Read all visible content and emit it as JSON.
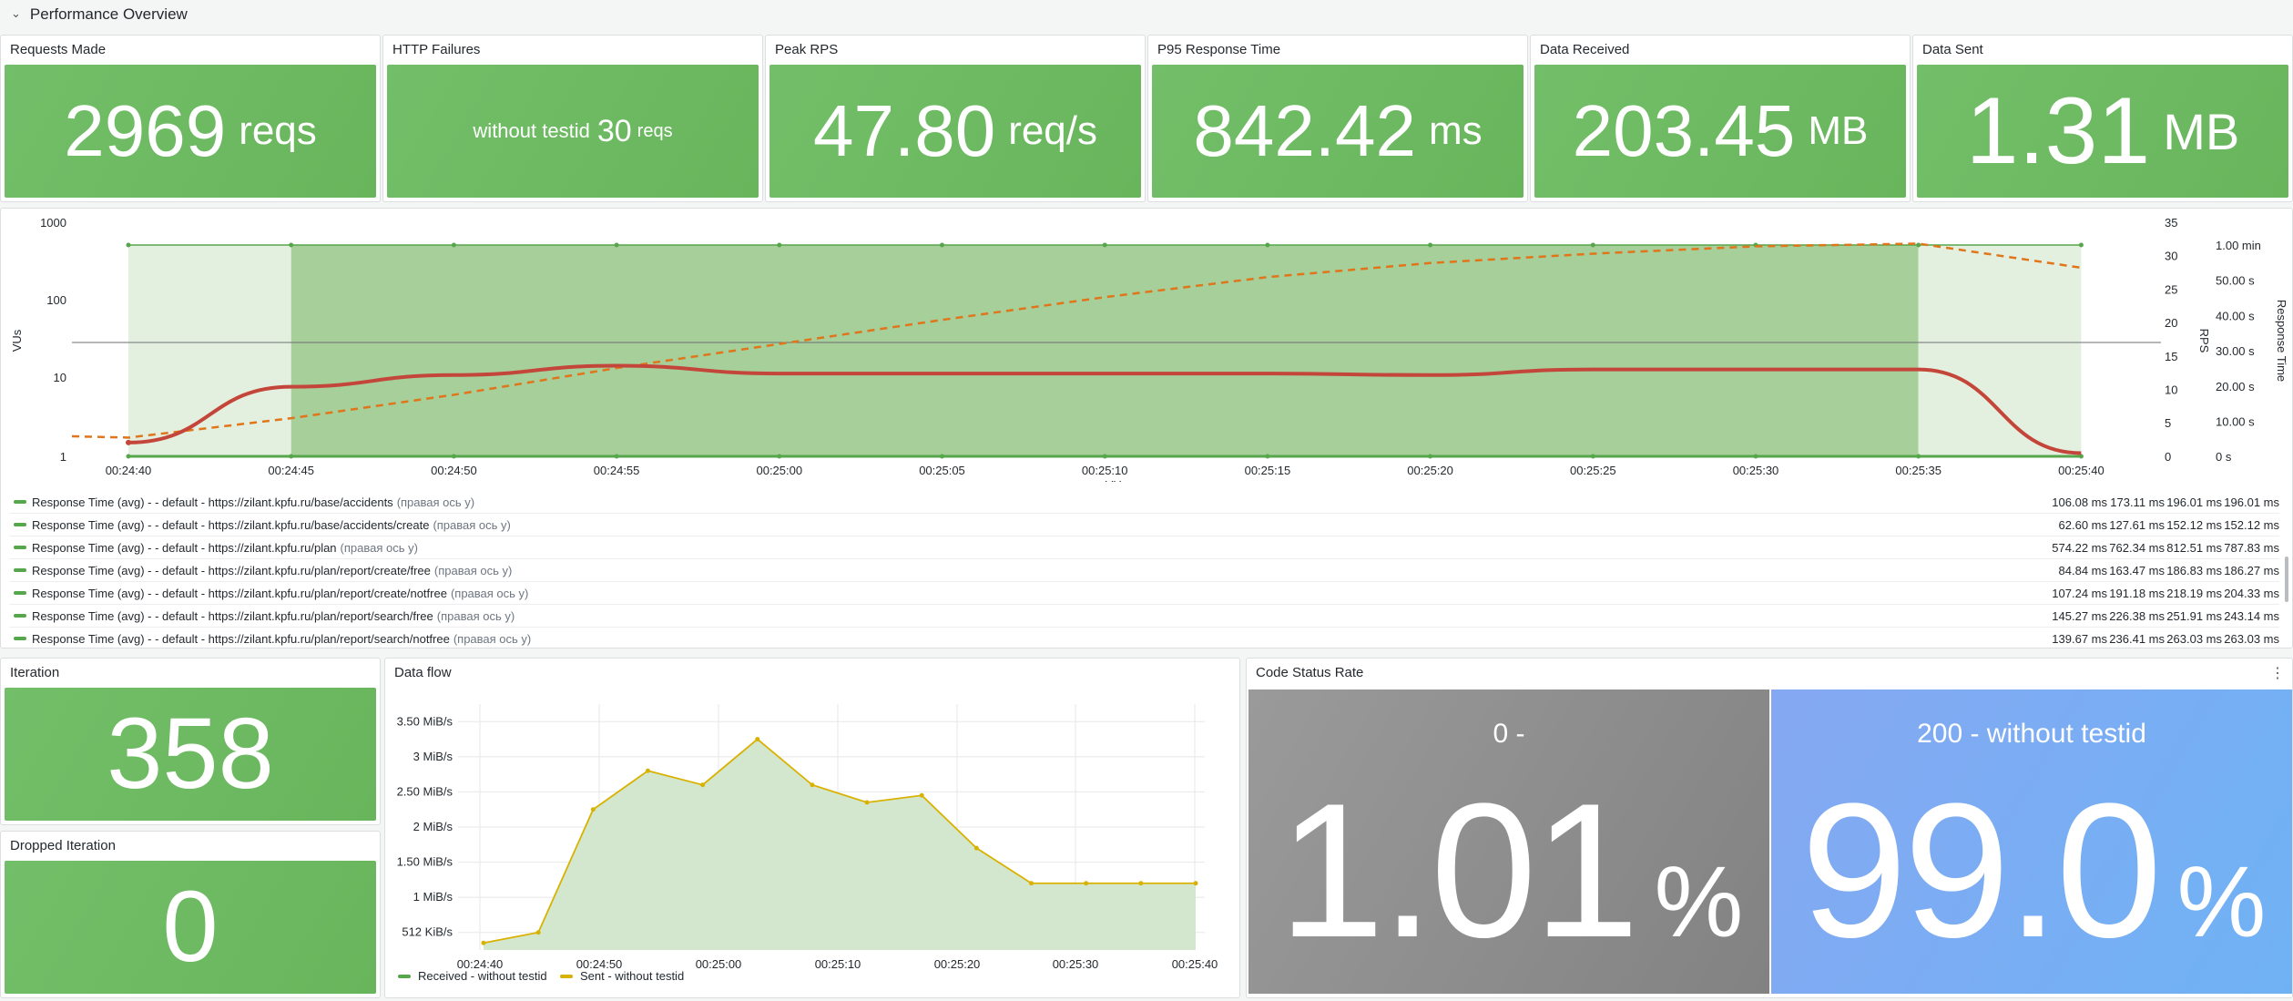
{
  "row": {
    "title": "Performance Overview",
    "chevron_icon": "chevron-down-icon"
  },
  "stats": {
    "requests": {
      "title": "Requests Made",
      "value": "2969",
      "unit": "reqs"
    },
    "failures": {
      "title": "HTTP Failures",
      "prefix": "without testid",
      "value": "30",
      "unit": "reqs"
    },
    "peak_rps": {
      "title": "Peak RPS",
      "value": "47.80",
      "unit": "req/s"
    },
    "p95": {
      "title": "P95 Response Time",
      "value": "842.42",
      "unit": "ms"
    },
    "received": {
      "title": "Data Received",
      "value": "203.45",
      "unit": "MB"
    },
    "sent": {
      "title": "Data Sent",
      "value": "1.31",
      "unit": "MB"
    },
    "iteration": {
      "title": "Iteration",
      "value": "358"
    },
    "dropped": {
      "title": "Dropped Iteration",
      "value": "0"
    }
  },
  "colors": {
    "stat_green": "#73bf69",
    "line_red": "#c4463a",
    "line_orange": "#e0751a",
    "gray_tile": "#8e8e8e",
    "blue_tile": "#7aa8f0"
  },
  "chart_data": [
    {
      "type": "line",
      "x_ticks": [
        "00:24:40",
        "00:24:45",
        "00:24:50",
        "00:24:55",
        "00:25:00",
        "00:25:05",
        "00:25:10",
        "00:25:15",
        "00:25:20",
        "00:25:25",
        "00:25:30",
        "00:25:35",
        "00:25:40"
      ],
      "xlabel": "VUs",
      "ylabel_left": "VUs",
      "ylabel_rps": "RPS",
      "ylabel_right": "Response Time",
      "left_ticks": [
        "1000",
        "100",
        "10",
        "1"
      ],
      "rps_ticks": [
        "35",
        "30",
        "25",
        "20",
        "15",
        "10",
        "5",
        "0"
      ],
      "rt_ticks": [
        "1.00 min",
        "50.00 s",
        "40.00 s",
        "30.00 s",
        "20.00 s",
        "10.00 s",
        "0 s"
      ],
      "vus_line": [
        1.5,
        7.8,
        11,
        14.5,
        11.5,
        11.5,
        11.5,
        11.5,
        11,
        13,
        13,
        13,
        1.1
      ],
      "rps_line": [
        2.8,
        5.7,
        9.2,
        13.2,
        16.8,
        20.4,
        23.8,
        26.8,
        28.9,
        30.3,
        31.4,
        31.8,
        28.2
      ],
      "legend": [
        {
          "label": "Response Time (avg) - - default - https://zilant.kpfu.ru/base/accidents",
          "suffix": "(правая ось y)",
          "v1": "106.08 ms",
          "v2": "173.11 ms",
          "v3": "196.01 ms",
          "v4": "196.01 ms"
        },
        {
          "label": "Response Time (avg) - - default - https://zilant.kpfu.ru/base/accidents/create",
          "suffix": "(правая ось y)",
          "v1": "62.60 ms",
          "v2": "127.61 ms",
          "v3": "152.12 ms",
          "v4": "152.12 ms"
        },
        {
          "label": "Response Time (avg) - - default - https://zilant.kpfu.ru/plan",
          "suffix": "(правая ось y)",
          "v1": "574.22 ms",
          "v2": "762.34 ms",
          "v3": "812.51 ms",
          "v4": "787.83 ms"
        },
        {
          "label": "Response Time (avg) - - default - https://zilant.kpfu.ru/plan/report/create/free",
          "suffix": "(правая ось y)",
          "v1": "84.84 ms",
          "v2": "163.47 ms",
          "v3": "186.83 ms",
          "v4": "186.27 ms"
        },
        {
          "label": "Response Time (avg) - - default - https://zilant.kpfu.ru/plan/report/create/notfree",
          "suffix": "(правая ось y)",
          "v1": "107.24 ms",
          "v2": "191.18 ms",
          "v3": "218.19 ms",
          "v4": "204.33 ms"
        },
        {
          "label": "Response Time (avg) - - default - https://zilant.kpfu.ru/plan/report/search/free",
          "suffix": "(правая ось y)",
          "v1": "145.27 ms",
          "v2": "226.38 ms",
          "v3": "251.91 ms",
          "v4": "243.14 ms"
        },
        {
          "label": "Response Time (avg) - - default - https://zilant.kpfu.ru/plan/report/search/notfree",
          "suffix": "(правая ось y)",
          "v1": "139.67 ms",
          "v2": "236.41 ms",
          "v3": "263.03 ms",
          "v4": "263.03 ms"
        }
      ]
    },
    {
      "type": "area",
      "title": "Data flow",
      "x_ticks": [
        "00:24:40",
        "00:24:50",
        "00:25:00",
        "00:25:10",
        "00:25:20",
        "00:25:30",
        "00:25:40"
      ],
      "y_ticks": [
        "3.50 MiB/s",
        "3 MiB/s",
        "2.50 MiB/s",
        "2 MiB/s",
        "1.50 MiB/s",
        "1 MiB/s",
        "512 KiB/s"
      ],
      "ylim_mib": [
        0.25,
        3.75
      ],
      "series": [
        {
          "name": "Received - without testid",
          "color": "#56a64b"
        },
        {
          "name": "Sent - without testid",
          "color": "#d9b100"
        }
      ],
      "values_mib": [
        0.35,
        0.5,
        2.25,
        2.8,
        2.6,
        3.25,
        2.6,
        2.35,
        2.45,
        1.7,
        1.2,
        1.2,
        1.2,
        1.2
      ]
    }
  ],
  "code_status": {
    "title": "Code Status Rate",
    "menu_icon": "kebab-menu-icon",
    "tiles": [
      {
        "label": "0 -",
        "value": "1.01",
        "unit": "%"
      },
      {
        "label": "200 - without testid",
        "value": "99.0",
        "unit": "%"
      }
    ]
  }
}
